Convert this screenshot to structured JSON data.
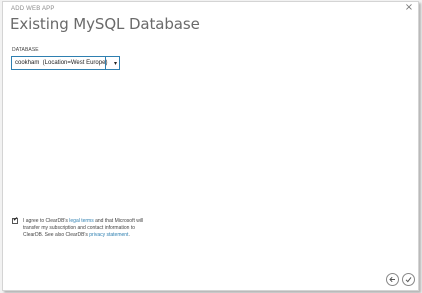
{
  "window": {
    "close_glyph": "×"
  },
  "header": {
    "subtitle": "ADD WEB APP",
    "title": "Existing MySQL Database"
  },
  "database": {
    "label": "DATABASE",
    "selected_value": "cookham  (Location=West Europe)",
    "arrow_glyph": "▾"
  },
  "agreement": {
    "checked": true,
    "check_glyph": "✔",
    "text_1": "I agree to ClearDB's ",
    "legal_terms_link": "legal terms",
    "text_2": " and that Microsoft will transfer my subscription and contact information to ClearDB. See also ClearDB's ",
    "privacy_link": "privacy statement",
    "text_3": "."
  },
  "footer": {
    "back_icon": "arrow-left-icon",
    "confirm_icon": "checkmark-icon"
  },
  "colors": {
    "accent": "#2e7fb0",
    "title_gray": "#6a6a6a"
  }
}
